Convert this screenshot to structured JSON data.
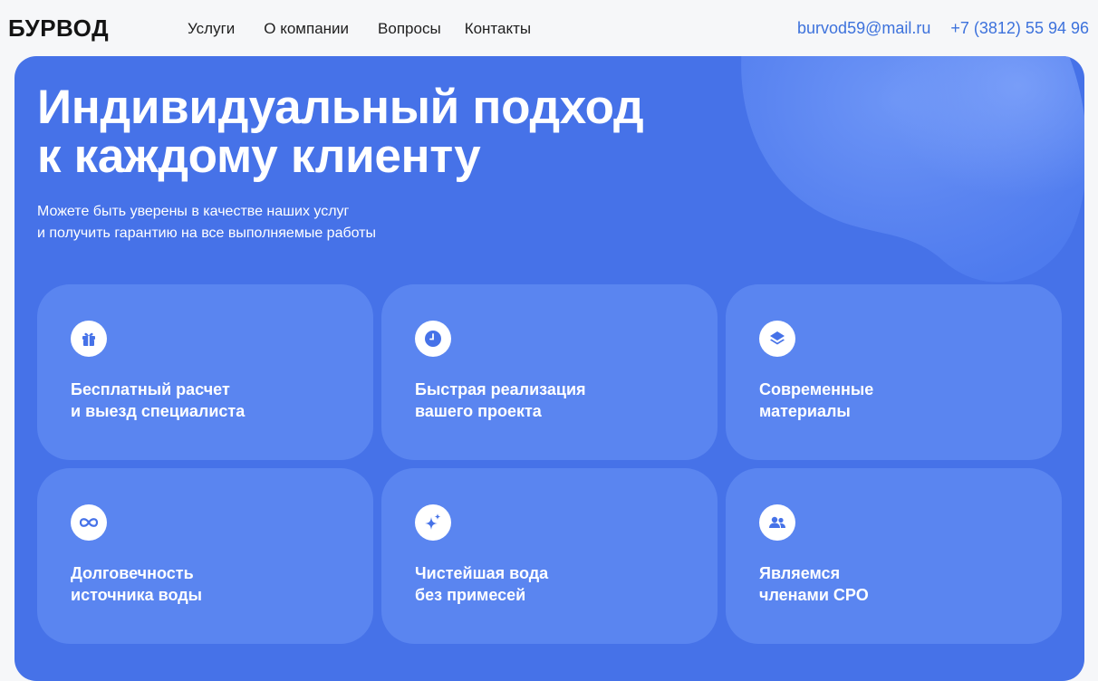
{
  "header": {
    "logo": "БУРВОД",
    "nav": [
      "Услуги",
      "О компании",
      "Вопросы",
      "Контакты"
    ],
    "email": "burvod59@mail.ru",
    "phone": "+7 (3812) 55 94 96"
  },
  "hero": {
    "title_line1": "Индивидуальный подход",
    "title_line2": "к каждому клиенту",
    "subtitle_line1": "Можете быть уверены в качестве наших услуг",
    "subtitle_line2": "и получить гарантию на все выполняемые работы"
  },
  "features": [
    {
      "icon": "gift-icon",
      "line1": "Бесплатный расчет",
      "line2": "и выезд специалиста"
    },
    {
      "icon": "clock-icon",
      "line1": "Быстрая реализация",
      "line2": "вашего проекта"
    },
    {
      "icon": "layers-icon",
      "line1": "Современные",
      "line2": "материалы"
    },
    {
      "icon": "infinity-icon",
      "line1": "Долговечность",
      "line2": "источника воды"
    },
    {
      "icon": "sparkle-icon",
      "line1": "Чистейшая вода",
      "line2": "без примесей"
    },
    {
      "icon": "people-icon",
      "line1": "Являемся",
      "line2": "членами СРО"
    }
  ],
  "colors": {
    "accent": "#4672e8",
    "card": "#5a85f0",
    "link": "#3d72dc"
  }
}
